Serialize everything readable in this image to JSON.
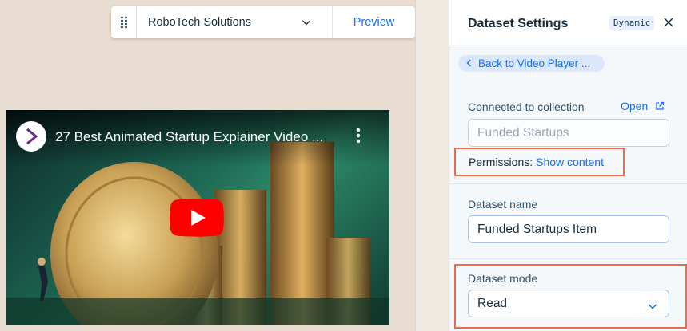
{
  "toolbar": {
    "site_select_value": "RoboTech Solutions",
    "preview_label": "Preview"
  },
  "video": {
    "title": "27 Best Animated Startup Explainer Video ..."
  },
  "panel": {
    "title": "Dataset Settings",
    "badge": "Dynamic",
    "back_label": "Back to Video Player ...",
    "collection_label": "Connected to collection",
    "open_label": "Open",
    "collection_value": "Funded Startups",
    "permissions_label": "Permissions:",
    "permissions_link": "Show content",
    "dataset_name_label": "Dataset name",
    "dataset_name_value": "Funded Startups Item",
    "dataset_mode_label": "Dataset mode",
    "dataset_mode_value": "Read"
  },
  "colors": {
    "accent": "#116dff",
    "highlight": "#ef6a4a",
    "canvas_bg": "#e8ddd0"
  },
  "icons": [
    "drag-handle-icon",
    "chevron-down-icon",
    "channel-avatar-icon",
    "more-vert-icon",
    "youtube-play-icon",
    "close-icon",
    "chevron-left-icon",
    "external-link-icon"
  ]
}
